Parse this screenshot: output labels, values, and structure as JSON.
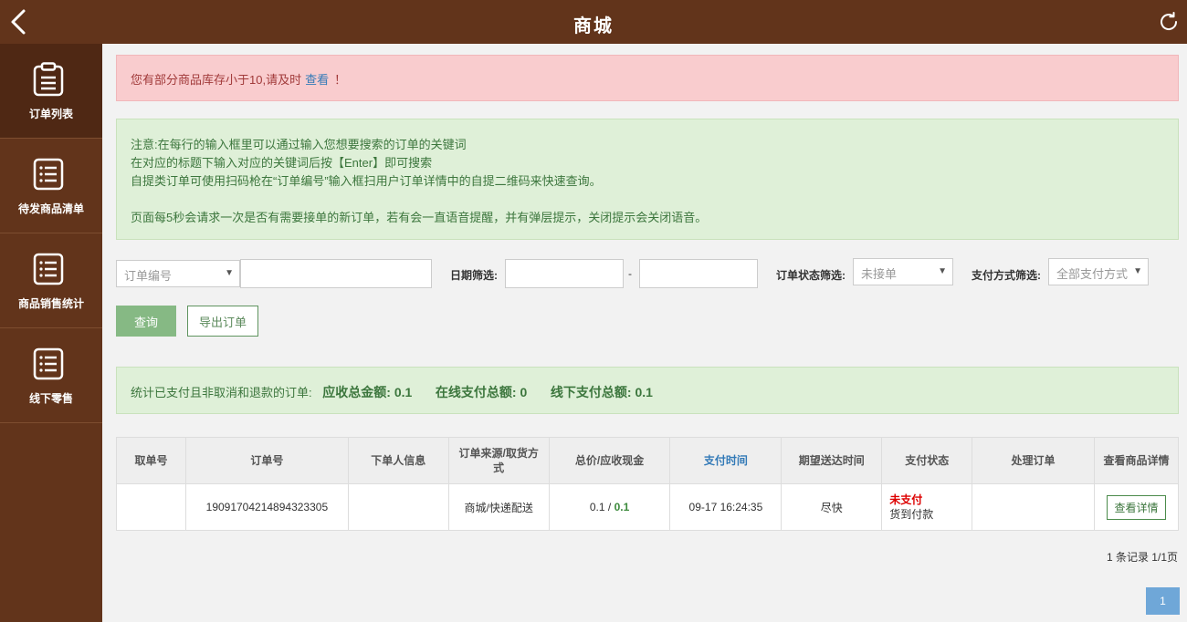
{
  "header": {
    "title": "商城",
    "back_icon": "chevron-left-icon",
    "refresh_icon": "refresh-icon"
  },
  "sidebar": {
    "items": [
      {
        "label": "订单列表",
        "icon": "clipboard-icon"
      },
      {
        "label": "待发商品清单",
        "icon": "list-icon"
      },
      {
        "label": "商品销售统计",
        "icon": "list-icon"
      },
      {
        "label": "线下零售",
        "icon": "list-icon"
      }
    ]
  },
  "alert": {
    "text": "您有部分商品库存小于10,请及时",
    "link": "查看",
    "suffix": "！"
  },
  "notice": {
    "line1": "注意:在每行的输入框里可以通过输入您想要搜索的订单的关键词",
    "line2": "在对应的标题下输入对应的关键词后按【Enter】即可搜索",
    "line3": "自提类订单可使用扫码枪在“订单编号”输入框扫用户订单详情中的自提二维码来快速查询。",
    "line4": "页面每5秒会请求一次是否有需要接单的新订单，若有会一直语音提醒，并有弹层提示，关闭提示会关闭语音。"
  },
  "filters": {
    "field_select": "订单编号",
    "date_label": "日期筛选:",
    "date_sep": "-",
    "status_label": "订单状态筛选:",
    "status_value": "未接单",
    "pay_label": "支付方式筛选:",
    "pay_value": "全部支付方式"
  },
  "buttons": {
    "query": "查询",
    "export": "导出订单"
  },
  "summary": {
    "prefix": "统计已支付且非取消和退款的订单:",
    "total_label": "应收总金额:",
    "total_value": "0.1",
    "online_label": "在线支付总额:",
    "online_value": "0",
    "offline_label": "线下支付总额:",
    "offline_value": "0.1"
  },
  "table": {
    "headers": [
      "取单号",
      "订单号",
      "下单人信息",
      "订单来源/取货方式",
      "总价/应收现金",
      "支付时间",
      "期望送达时间",
      "支付状态",
      "处理订单",
      "查看商品详情"
    ],
    "rows": [
      {
        "pickup_no": "",
        "order_no": "19091704214894323305",
        "customer": "",
        "source": "商城/快递配送",
        "total": "0.1",
        "cash": "0.1",
        "pay_time": "09-17 16:24:35",
        "expected": "尽快",
        "pay_status": "未支付",
        "pay_method": "货到付款",
        "process": "",
        "detail_btn": "查看详情"
      }
    ]
  },
  "pagination": {
    "records": "1 条记录 1/1页",
    "page": "1"
  },
  "colors": {
    "brand": "#62341b",
    "success_bg": "#dff0d8",
    "danger_bg": "#f9ccce",
    "primary": "#6fa7d8"
  }
}
